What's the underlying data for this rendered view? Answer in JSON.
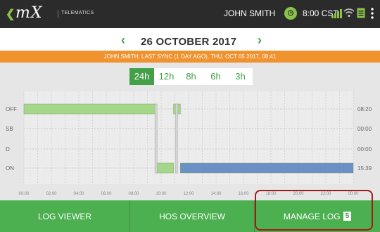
{
  "topbar": {
    "back_icon": "chevron-left-icon",
    "logo_text": "mX",
    "logo_subtitle": "TELEMATICS",
    "driver_name": "JOHN SMITH",
    "time": "8:00 CST",
    "icons": [
      "clock-icon",
      "signal-icon",
      "wifi-icon",
      "document-icon",
      "menu-icon"
    ]
  },
  "date_nav": {
    "prev": "‹",
    "title": "26 OCTOBER 2017",
    "next": "›"
  },
  "sync_banner": "JOHN SMITH: LAST SYNC (1 DAY AGO), THU, OCT 05 2017, 08:41",
  "range_tabs": [
    "24h",
    "12h",
    "8h",
    "6h",
    "3h"
  ],
  "active_range": "24h",
  "log_chart": {
    "status_labels": [
      "OFF",
      "SB",
      "D",
      "ON"
    ],
    "totals": [
      "08:20",
      "00:00",
      "00:00",
      "15:39"
    ],
    "x_ticks": [
      "00:00",
      "02:00",
      "04:00",
      "06:00",
      "08:00",
      "10:00",
      "12:00",
      "14:00",
      "16:00",
      "18:00",
      "20:00",
      "22:00",
      "00:00"
    ],
    "segments": [
      {
        "status": "OFF",
        "start_h": 0.0,
        "end_h": 9.6,
        "color": "#a5d68a"
      },
      {
        "status": "ON",
        "start_h": 9.6,
        "end_h": 10.9,
        "color": "#a5d68a"
      },
      {
        "status": "OFF",
        "start_h": 10.9,
        "end_h": 11.4,
        "color": "#a5d68a"
      },
      {
        "status": "ON",
        "start_h": 11.4,
        "end_h": 24.0,
        "color": "#6b8fc7"
      }
    ],
    "marker_hours": [
      9.6,
      11.1
    ]
  },
  "colors": {
    "accent_green": "#43a047",
    "banner_orange": "#f0922e",
    "on_duty_blue": "#6b8fc7",
    "off_duty_green": "#a5d68a",
    "highlight": "#a31a1a"
  },
  "bottom_nav": {
    "log_viewer": "LOG VIEWER",
    "hos_overview": "HOS OVERVIEW",
    "manage_log": "MANAGE LOG",
    "manage_log_badge": "5"
  }
}
